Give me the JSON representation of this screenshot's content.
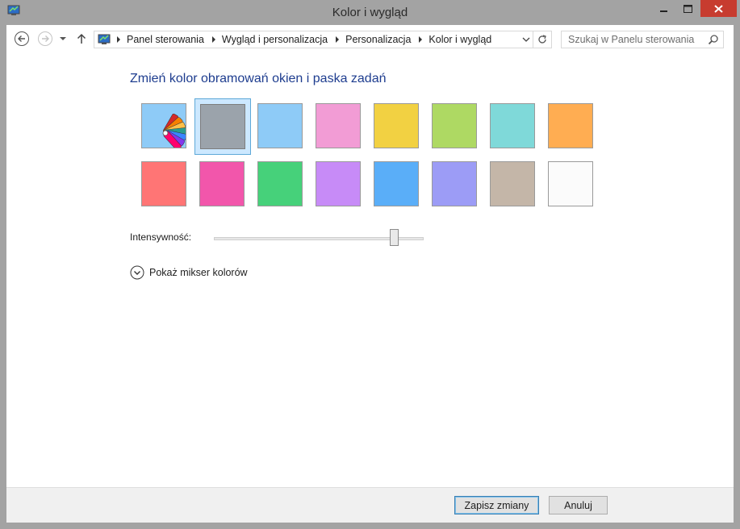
{
  "window": {
    "title": "Kolor i wygląd",
    "icon": "control-panel-icon"
  },
  "titlebar_buttons": {
    "minimize": "minimize-icon",
    "maximize": "maximize-icon",
    "close": "close-icon"
  },
  "navbar": {
    "back": "back-arrow-icon",
    "forward": "forward-arrow-icon",
    "recent": "chevron-down-icon",
    "up": "up-arrow-icon",
    "breadcrumbs": [
      "Panel sterowania",
      "Wygląd i personalizacja",
      "Personalizacja",
      "Kolor i wygląd"
    ],
    "refresh": "refresh-icon"
  },
  "search": {
    "placeholder": "Szukaj w Panelu sterowania",
    "value": ""
  },
  "main": {
    "heading": "Zmień kolor obramowań okien i paska zadań",
    "swatches_row1": [
      "auto",
      "#9ba3ab",
      "#8ecbf7",
      "#f29cd5",
      "#f2d142",
      "#aed963",
      "#7fd9d9",
      "#ffad52"
    ],
    "swatches_row2": [
      "#ff7575",
      "#f256ab",
      "#46d17a",
      "#c78bf7",
      "#5aaef8",
      "#9c9cf6",
      "#c4b6a8",
      "#fbfbfb"
    ],
    "selected_swatch": 1,
    "intensity_label": "Intensywność:",
    "intensity_value": 0.86,
    "mixer_label": "Pokaż mikser kolorów"
  },
  "footer": {
    "save_label": "Zapisz zmiany",
    "cancel_label": "Anuluj"
  },
  "colors": {
    "accent": "#1e3d8f",
    "close_button": "#c73c2f",
    "selection": "#cce8ff"
  }
}
